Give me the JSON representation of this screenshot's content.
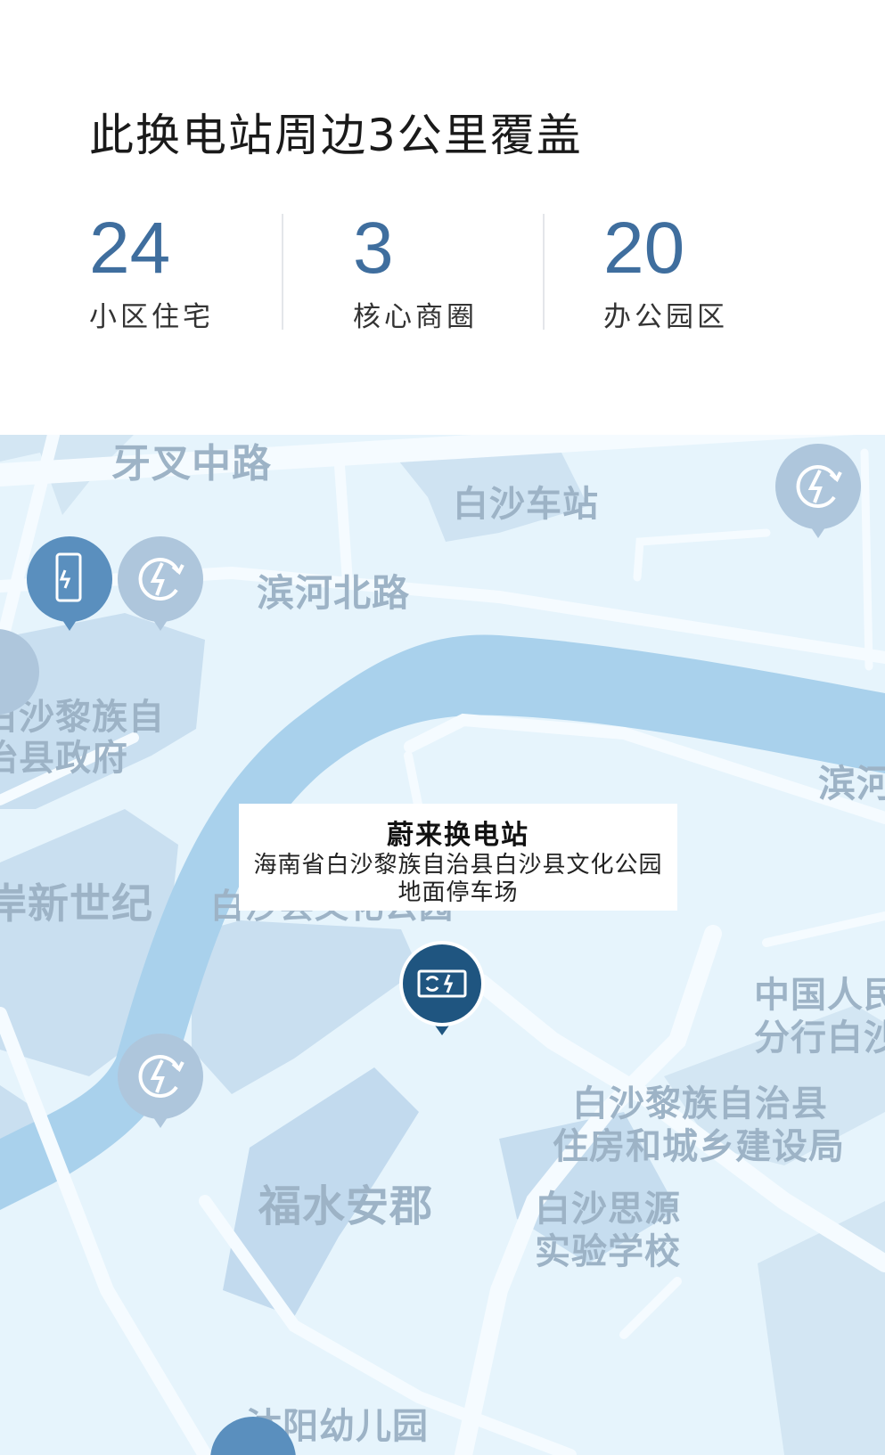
{
  "header": {
    "title": "此换电站周边3公里覆盖",
    "stats": [
      {
        "value": "24",
        "label": "小区住宅"
      },
      {
        "value": "3",
        "label": "核心商圈"
      },
      {
        "value": "20",
        "label": "办公园区"
      }
    ]
  },
  "map": {
    "station_card": {
      "name": "蔚来换电站",
      "address": "海南省白沙黎族自治县白沙县文化公园地面停车场"
    },
    "labels": {
      "road_yachazhong": "牙叉中路",
      "bus_station": "白沙车站",
      "road_binhebei": "滨河北路",
      "gov_line1": "白沙黎族自",
      "gov_line2": "治县政府",
      "new_century": "岸新世纪",
      "culture_park": "白沙县文化公园",
      "binhe_right": "滨河",
      "bank_line1": "中国人民",
      "bank_line2": "分行白沙",
      "housing_line1": "白沙黎族自治县",
      "housing_line2": "住房和城乡建设局",
      "fushui": "福水安郡",
      "school_line1": "白沙思源",
      "school_line2": "实验学校",
      "kindergarten": "沐阳幼儿园"
    },
    "pins": [
      {
        "name": "swap-station-selected",
        "icon": "battery-swap-icon"
      },
      {
        "name": "charger-pin",
        "icon": "charging-bolt-icon"
      },
      {
        "name": "phone-charger-pin",
        "icon": "charging-pile-icon"
      }
    ],
    "colors": {
      "land": "#e6f4fc",
      "block": "#c9dff0",
      "water": "#a9d1ec",
      "road": "#f5fbff",
      "label": "#9db3c6",
      "selected_pin": "#1f5580",
      "pin": "#aec6dc",
      "pin_active": "#5a8fbe"
    }
  }
}
